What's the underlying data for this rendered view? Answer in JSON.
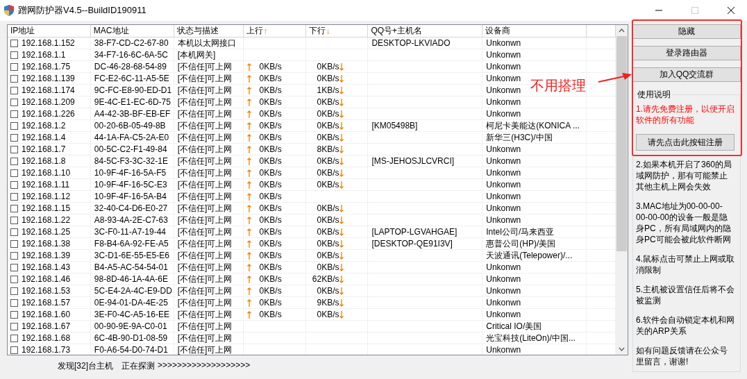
{
  "window": {
    "title": "蹭网防护器V4.5--BuildID190911"
  },
  "table": {
    "columns": [
      {
        "label": "IP地址"
      },
      {
        "label": "MAC地址"
      },
      {
        "label": "状态与描述"
      },
      {
        "label": "上行",
        "arrow": "↑"
      },
      {
        "label": "下行",
        "arrow": "↓"
      },
      {
        "label": "QQ号+主机名"
      },
      {
        "label": "设备商"
      }
    ],
    "rows": [
      {
        "checked": false,
        "ip": "192.168.1.152",
        "mac": "38-F7-CD-C2-67-80",
        "status": "本机以太网接口",
        "host": "DESKTOP-LKVIADO",
        "vendor": "Unkonwn"
      },
      {
        "checked": false,
        "ip": "192.168.1.1",
        "mac": "34-F7-16-6C-6A-5C",
        "status": "[本机网关]",
        "vendor": "Unkonwn"
      },
      {
        "checked": false,
        "ip": "192.168.1.75",
        "mac": "DC-46-28-68-54-89",
        "status": "[不信任]可上网",
        "up": "0KB/s",
        "down": "0KB/s",
        "vendor": "Unkonwn"
      },
      {
        "checked": false,
        "ip": "192.168.1.139",
        "mac": "FC-E2-6C-11-A5-5E",
        "status": "[不信任]可上网",
        "up": "0KB/s",
        "down": "0KB/s",
        "vendor": "Unkonwn"
      },
      {
        "checked": false,
        "ip": "192.168.1.174",
        "mac": "9C-FC-E8-90-ED-D1",
        "status": "[不信任]可上网",
        "up": "0KB/s",
        "down": "1KB/s",
        "vendor": "Unkonwn"
      },
      {
        "checked": false,
        "ip": "192.168.1.209",
        "mac": "9E-4C-E1-EC-6D-75",
        "status": "[不信任]可上网",
        "up": "0KB/s",
        "down": "0KB/s",
        "vendor": "Unkonwn"
      },
      {
        "checked": false,
        "ip": "192.168.1.226",
        "mac": "A4-42-3B-BF-EB-EF",
        "status": "[不信任]可上网",
        "up": "0KB/s",
        "down": "0KB/s",
        "vendor": "Unkonwn"
      },
      {
        "checked": false,
        "ip": "192.168.1.2",
        "mac": "00-20-6B-05-49-8B",
        "status": "[不信任]可上网",
        "up": "0KB/s",
        "down": "0KB/s",
        "host": "[KM05498B]",
        "vendor": "柯尼卡美能达(KONICA ..."
      },
      {
        "checked": false,
        "ip": "192.168.1.4",
        "mac": "44-1A-FA-C5-2A-E0",
        "status": "[不信任]可上网",
        "up": "0KB/s",
        "down": "0KB/s",
        "vendor": "新华三(H3C)/中国"
      },
      {
        "checked": false,
        "ip": "192.168.1.7",
        "mac": "00-5C-C2-F1-49-84",
        "status": "[不信任]可上网",
        "up": "0KB/s",
        "down": "8KB/s",
        "vendor": "Unkonwn"
      },
      {
        "checked": false,
        "ip": "192.168.1.8",
        "mac": "84-5C-F3-3C-32-1E",
        "status": "[不信任]可上网",
        "up": "0KB/s",
        "down": "0KB/s",
        "host": "[MS-JEHOSJLCVRCI]",
        "vendor": "Unkonwn"
      },
      {
        "checked": false,
        "ip": "192.168.1.10",
        "mac": "10-9F-4F-16-5A-F5",
        "status": "[不信任]可上网",
        "up": "0KB/s",
        "down": "0KB/s",
        "vendor": "Unkonwn"
      },
      {
        "checked": false,
        "ip": "192.168.1.11",
        "mac": "10-9F-4F-16-5C-E3",
        "status": "[不信任]可上网",
        "up": "0KB/s",
        "down": "0KB/s",
        "vendor": "Unkonwn"
      },
      {
        "checked": false,
        "ip": "192.168.1.12",
        "mac": "10-9F-4F-16-5A-B4",
        "status": "[不信任]可上网",
        "up": "0KB/s",
        "vendor": "Unkonwn"
      },
      {
        "checked": false,
        "ip": "192.168.1.15",
        "mac": "32-40-C4-D6-E0-27",
        "status": "[不信任]可上网",
        "up": "0KB/s",
        "down": "0KB/s",
        "vendor": "Unkonwn"
      },
      {
        "checked": false,
        "ip": "192.168.1.22",
        "mac": "A8-93-4A-2E-C7-63",
        "status": "[不信任]可上网",
        "up": "0KB/s",
        "down": "0KB/s",
        "vendor": "Unkonwn"
      },
      {
        "checked": false,
        "ip": "192.168.1.25",
        "mac": "3C-F0-11-A7-19-44",
        "status": "[不信任]可上网",
        "up": "0KB/s",
        "down": "0KB/s",
        "host": "[LAPTOP-LGVAHGAE]",
        "vendor": "Intel公司/马来西亚"
      },
      {
        "checked": false,
        "ip": "192.168.1.38",
        "mac": "F8-B4-6A-92-FE-A5",
        "status": "[不信任]可上网",
        "up": "0KB/s",
        "down": "0KB/s",
        "host": "[DESKTOP-QE91I3V]",
        "vendor": "惠普公司(HP)/美国"
      },
      {
        "checked": false,
        "ip": "192.168.1.39",
        "mac": "3C-D1-6E-55-E5-E6",
        "status": "[不信任]可上网",
        "up": "0KB/s",
        "down": "0KB/s",
        "vendor": "天波通讯(Telepower)/..."
      },
      {
        "checked": false,
        "ip": "192.168.1.43",
        "mac": "B4-A5-AC-54-54-01",
        "status": "[不信任]可上网",
        "up": "0KB/s",
        "down": "0KB/s",
        "vendor": "Unkonwn"
      },
      {
        "checked": false,
        "ip": "192.168.1.46",
        "mac": "98-8D-46-1A-4A-6E",
        "status": "[不信任]可上网",
        "up": "0KB/s",
        "down": "62KB/s",
        "vendor": "Unkonwn"
      },
      {
        "checked": false,
        "ip": "192.168.1.53",
        "mac": "5C-E4-2A-4C-E9-DD",
        "status": "[不信任]可上网",
        "up": "0KB/s",
        "down": "0KB/s",
        "vendor": "Unkonwn"
      },
      {
        "checked": false,
        "ip": "192.168.1.57",
        "mac": "0E-94-01-DA-4E-25",
        "status": "[不信任]可上网",
        "up": "0KB/s",
        "down": "9KB/s",
        "vendor": "Unkonwn"
      },
      {
        "checked": false,
        "ip": "192.168.1.60",
        "mac": "3E-F0-4C-A5-16-EE",
        "status": "[不信任]可上网",
        "up": "0KB/s",
        "down": "0KB/s",
        "vendor": "Unkonwn"
      },
      {
        "checked": false,
        "ip": "192.168.1.67",
        "mac": "00-90-9E-9A-C0-01",
        "status": "[不信任]可上网",
        "vendor": "Critical IO/美国"
      },
      {
        "checked": false,
        "ip": "192.168.1.68",
        "mac": "6C-4B-90-D1-08-59",
        "status": "[不信任]可上网",
        "vendor": "光宝科技(LiteOn)/中国..."
      },
      {
        "checked": false,
        "ip": "192.168.1.73",
        "mac": "F0-A6-54-D0-74-D1",
        "status": "[不信任]可上网",
        "vendor": "Unkonwn"
      }
    ]
  },
  "sidebar": {
    "buttons": [
      "隐藏",
      "登录路由器",
      "加入QQ交流群"
    ],
    "help": {
      "title": "使用说明",
      "notes": [
        {
          "kind": "warning",
          "text": "1.请先免费注册，以便开启软件的所有功能"
        },
        {
          "kind": "button",
          "text": "请先点击此按钮注册"
        },
        {
          "kind": "note",
          "text": "2.如果本机开启了360的局域网防护，那有可能禁止其他主机上网会失效"
        },
        {
          "kind": "note",
          "text": "3.MAC地址为00-00-00-00-00-00的设备一般是隐身PC，所有局域网内的隐身PC可能会被此软件断网"
        },
        {
          "kind": "note",
          "text": "4.鼠标点击可禁止上网或取消限制"
        },
        {
          "kind": "note",
          "text": "5.主机被设置信任后将不会被监测"
        },
        {
          "kind": "note",
          "text": "6.软件会自动锁定本机和网关的ARP关系"
        },
        {
          "kind": "note",
          "text": "如有问题反馈请在公众号里留言，谢谢!"
        }
      ]
    }
  },
  "status_bar": {
    "found": "发现[32]台主机",
    "progress_label": "正在探测",
    "progress_marks": ">>>>>>>>>>>>>>>>>>>"
  },
  "annotation": {
    "text": "不用搭理"
  }
}
